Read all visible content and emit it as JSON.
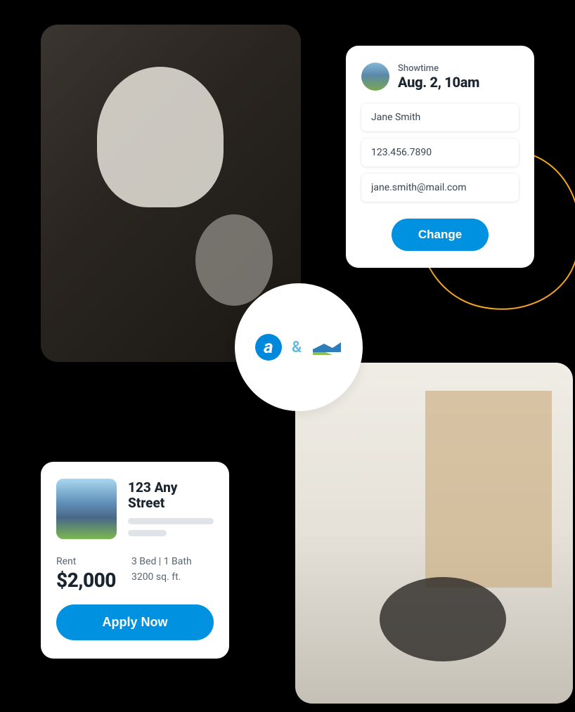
{
  "showtime": {
    "label": "Showtime",
    "datetime": "Aug. 2, 10am",
    "name": "Jane Smith",
    "phone": "123.456.7890",
    "email": "jane.smith@mail.com",
    "change_label": "Change"
  },
  "center": {
    "logo_a": "a",
    "ampersand": "&"
  },
  "listing": {
    "address": "123 Any Street",
    "rent_label": "Rent",
    "price": "$2,000",
    "beds_baths": "3 Bed  |  1 Bath",
    "sqft": "3200 sq. ft.",
    "apply_label": "Apply Now"
  }
}
